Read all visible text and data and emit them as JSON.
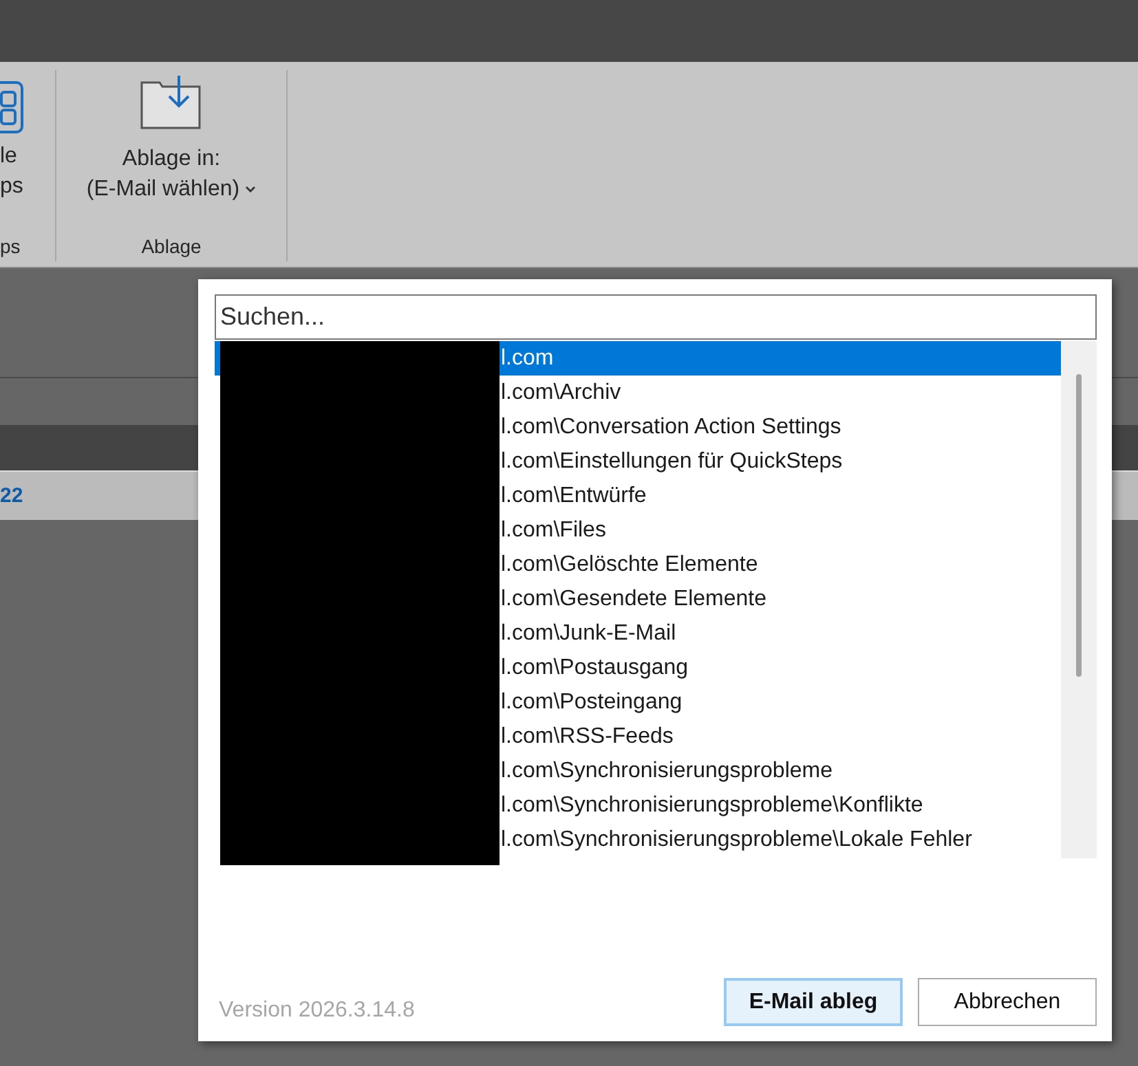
{
  "ribbon": {
    "groups": [
      {
        "kind": "partial",
        "lines": [
          "le",
          "ps"
        ],
        "group_label": "ps"
      },
      {
        "kind": "file",
        "lines": [
          "Ablage in:",
          "(E-Mail wählen)"
        ],
        "group_label": "Ablage"
      }
    ]
  },
  "mail_list": {
    "row_text": "22"
  },
  "dialog": {
    "search": {
      "placeholder": "Suchen..."
    },
    "redacted": true,
    "folders": [
      {
        "label": "l.com",
        "selected": true
      },
      {
        "label": "l.com\\Archiv",
        "selected": false
      },
      {
        "label": "l.com\\Conversation Action Settings",
        "selected": false
      },
      {
        "label": "l.com\\Einstellungen für QuickSteps",
        "selected": false
      },
      {
        "label": "l.com\\Entwürfe",
        "selected": false
      },
      {
        "label": "l.com\\Files",
        "selected": false
      },
      {
        "label": "l.com\\Gelöschte Elemente",
        "selected": false
      },
      {
        "label": "l.com\\Gesendete Elemente",
        "selected": false
      },
      {
        "label": "l.com\\Junk-E-Mail",
        "selected": false
      },
      {
        "label": "l.com\\Postausgang",
        "selected": false
      },
      {
        "label": "l.com\\Posteingang",
        "selected": false
      },
      {
        "label": "l.com\\RSS-Feeds",
        "selected": false
      },
      {
        "label": "l.com\\Synchronisierungsprobleme",
        "selected": false
      },
      {
        "label": "l.com\\Synchronisierungsprobleme\\Konflikte",
        "selected": false
      },
      {
        "label": "l.com\\Synchronisierungsprobleme\\Lokale Fehler",
        "selected": false
      }
    ],
    "version": "Version 2026.3.14.8",
    "buttons": [
      {
        "label": "E-Mail ableg",
        "default": true
      },
      {
        "label": "Abbrechen",
        "default": false
      }
    ]
  }
}
